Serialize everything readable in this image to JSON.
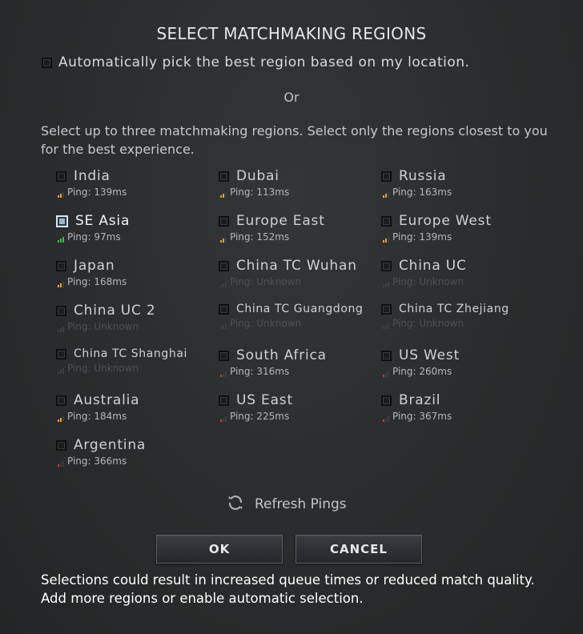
{
  "dialog": {
    "title": "SELECT MATCHMAKING REGIONS",
    "auto_pick_label": "Automatically pick the best region based on my location.",
    "or_label": "Or",
    "instructions": "Select up to three matchmaking regions. Select only the regions closest to you for the best experience.",
    "refresh_label": "Refresh Pings",
    "ok_label": "OK",
    "cancel_label": "CANCEL",
    "warning": "Selections could result in increased queue times or reduced match quality.  Add more regions or enable automatic selection."
  },
  "colors": {
    "good": "#3fb84a",
    "medium": "#e8a23a",
    "poor": "#d2382e",
    "unknown": "#3c3e3f"
  },
  "regions": [
    {
      "name": "India",
      "ping": "Ping: 139ms",
      "quality": "medium",
      "bars": 2,
      "checked": false
    },
    {
      "name": "Dubai",
      "ping": "Ping: 113ms",
      "quality": "medium",
      "bars": 2,
      "checked": false
    },
    {
      "name": "Russia",
      "ping": "Ping: 163ms",
      "quality": "medium",
      "bars": 2,
      "checked": false
    },
    {
      "name": "SE Asia",
      "ping": "Ping: 97ms",
      "quality": "good",
      "bars": 3,
      "checked": true
    },
    {
      "name": "Europe East",
      "ping": "Ping: 152ms",
      "quality": "medium",
      "bars": 2,
      "checked": false
    },
    {
      "name": "Europe West",
      "ping": "Ping: 139ms",
      "quality": "medium",
      "bars": 2,
      "checked": false
    },
    {
      "name": "Japan",
      "ping": "Ping: 168ms",
      "quality": "medium",
      "bars": 2,
      "checked": false
    },
    {
      "name": "China TC Wuhan",
      "ping": "Ping: Unknown",
      "quality": "unknown",
      "bars": 0,
      "checked": false
    },
    {
      "name": "China UC",
      "ping": "Ping: Unknown",
      "quality": "unknown",
      "bars": 0,
      "checked": false
    },
    {
      "name": "China UC 2",
      "ping": "Ping: Unknown",
      "quality": "unknown",
      "bars": 0,
      "checked": false
    },
    {
      "name": "China TC Guangdong",
      "ping": "Ping: Unknown",
      "quality": "unknown",
      "bars": 0,
      "checked": false
    },
    {
      "name": "China TC Zhejiang",
      "ping": "Ping: Unknown",
      "quality": "unknown",
      "bars": 0,
      "checked": false
    },
    {
      "name": "China TC Shanghai",
      "ping": "Ping: Unknown",
      "quality": "unknown",
      "bars": 0,
      "checked": false
    },
    {
      "name": "South Africa",
      "ping": "Ping: 316ms",
      "quality": "poor",
      "bars": 1,
      "checked": false
    },
    {
      "name": "US West",
      "ping": "Ping: 260ms",
      "quality": "poor",
      "bars": 1,
      "checked": false
    },
    {
      "name": "Australia",
      "ping": "Ping: 184ms",
      "quality": "medium",
      "bars": 2,
      "checked": false
    },
    {
      "name": "US East",
      "ping": "Ping: 225ms",
      "quality": "poor",
      "bars": 1,
      "checked": false
    },
    {
      "name": "Brazil",
      "ping": "Ping: 367ms",
      "quality": "poor",
      "bars": 1,
      "checked": false
    },
    {
      "name": "Argentina",
      "ping": "Ping: 366ms",
      "quality": "poor",
      "bars": 1,
      "checked": false
    }
  ]
}
